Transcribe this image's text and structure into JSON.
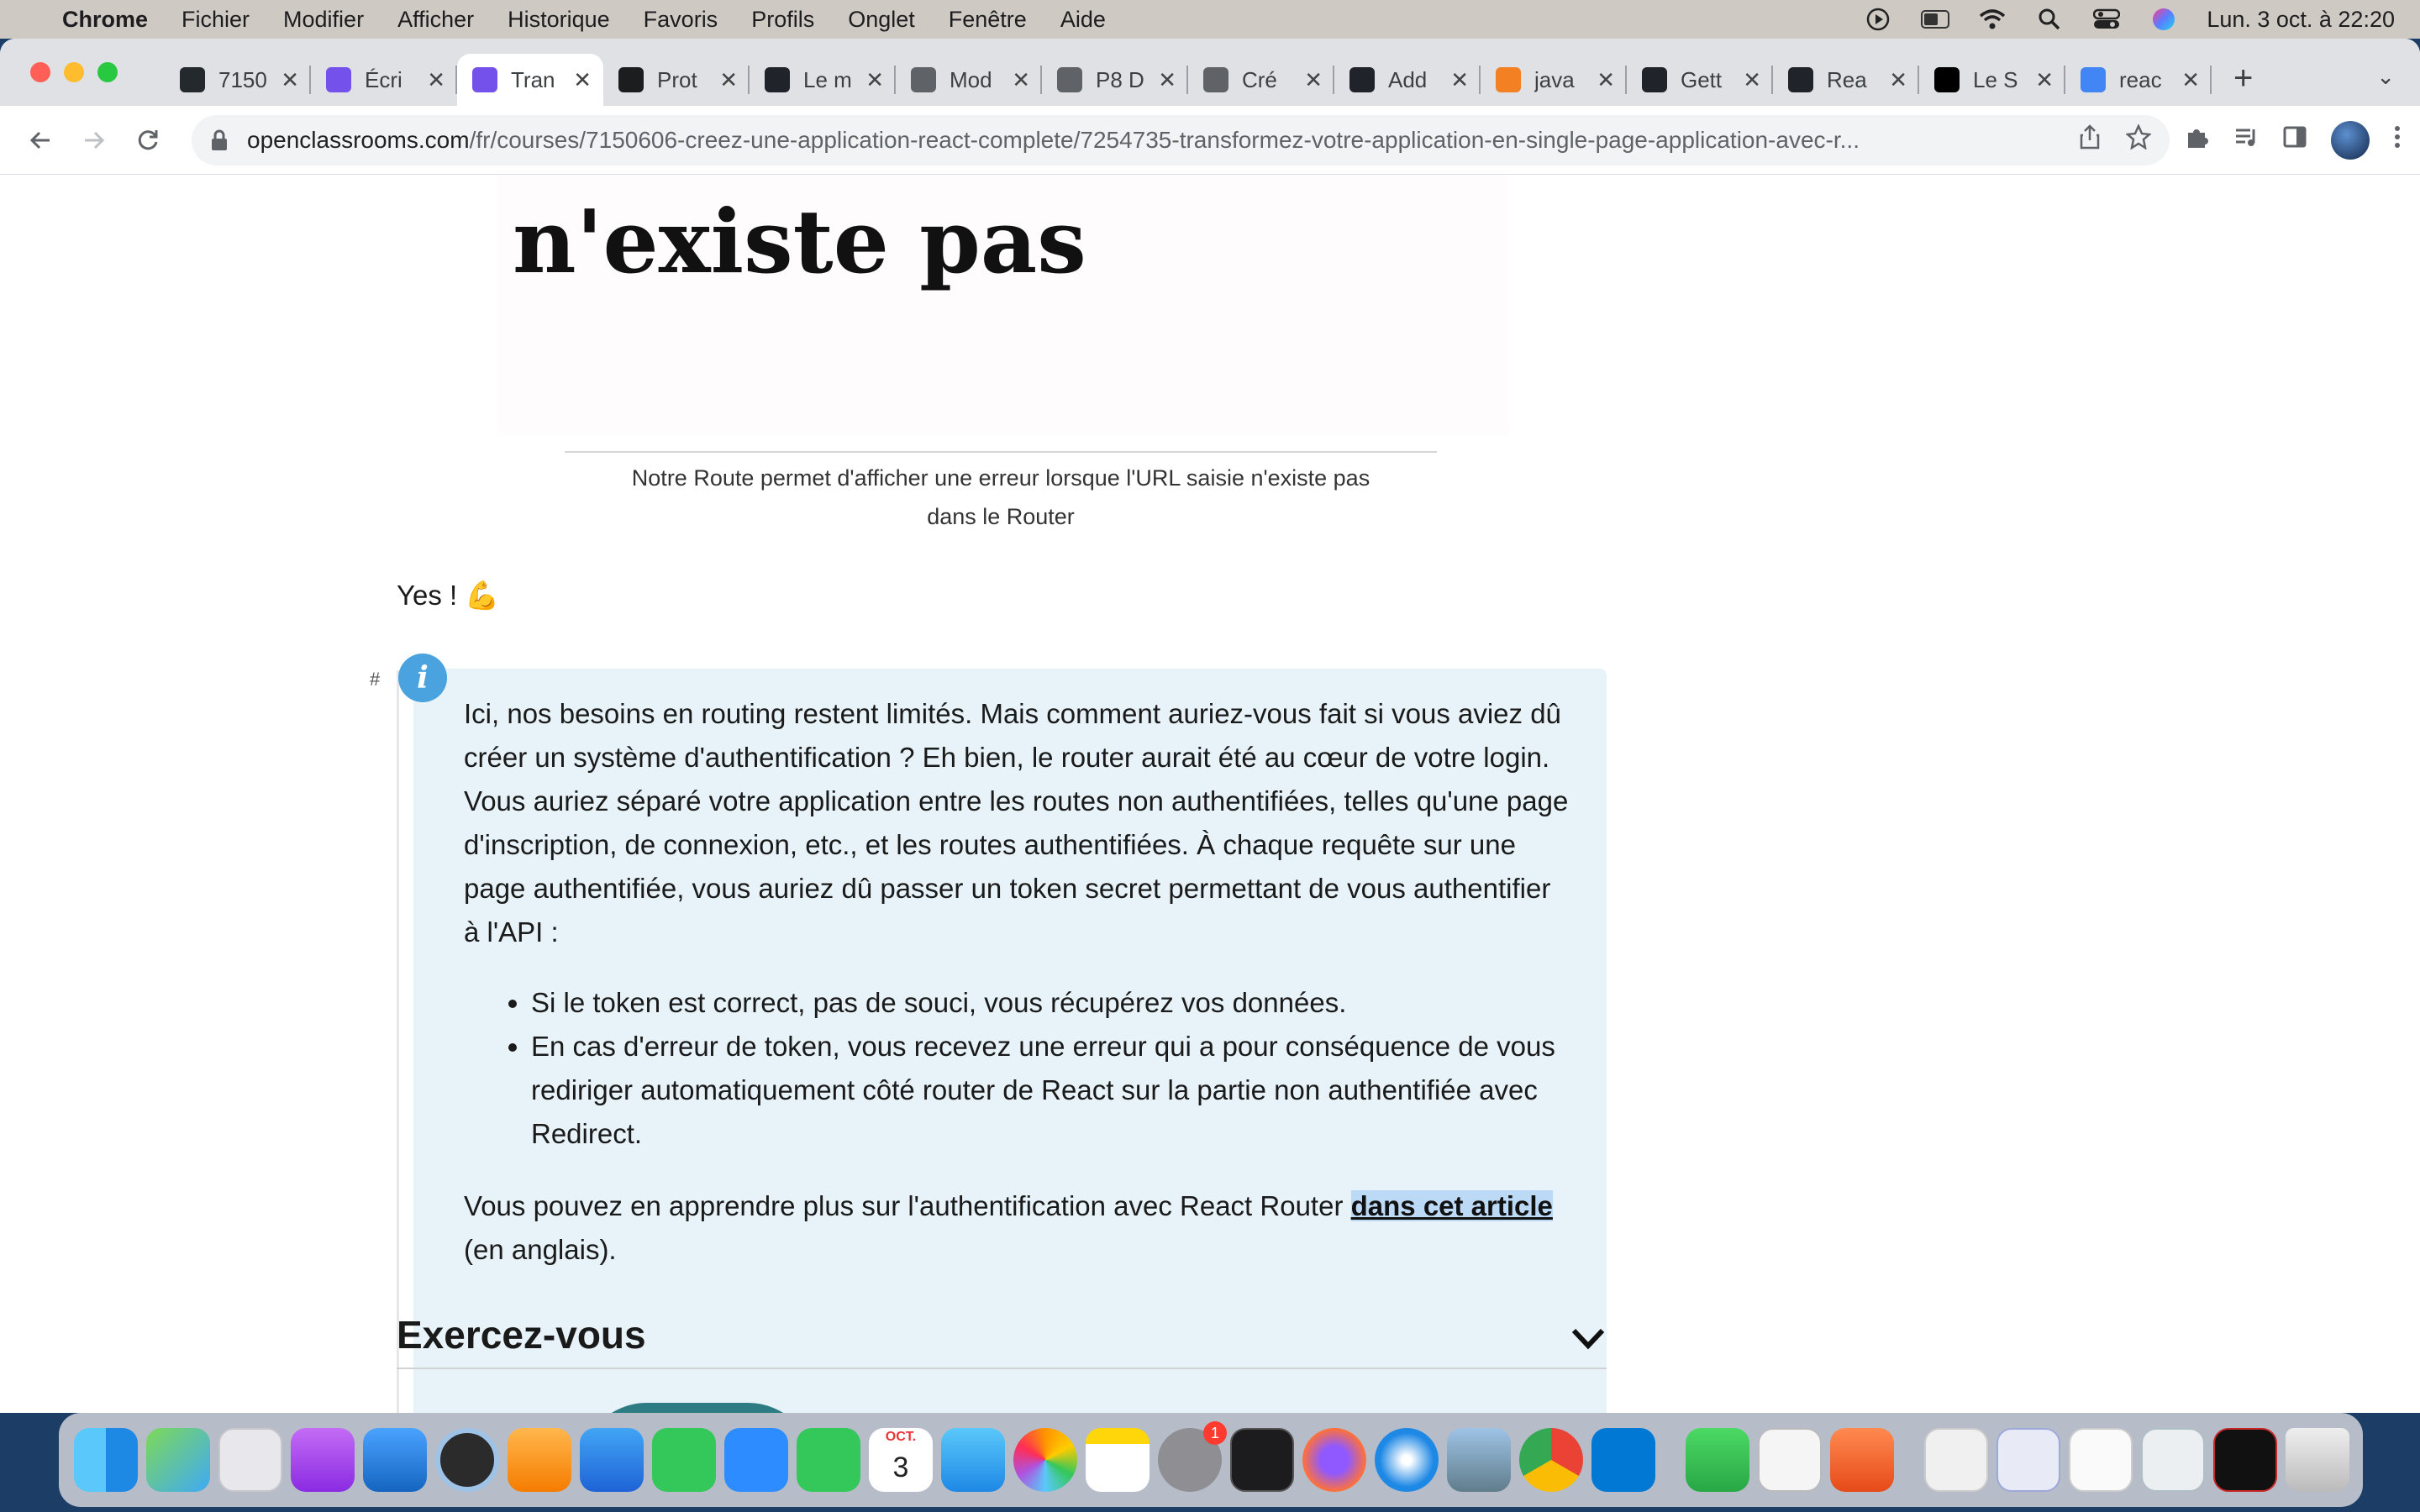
{
  "menubar": {
    "app": "Chrome",
    "items": [
      "Fichier",
      "Modifier",
      "Afficher",
      "Historique",
      "Favoris",
      "Profils",
      "Onglet",
      "Fenêtre",
      "Aide"
    ],
    "clock": "Lun. 3 oct. à  22:20"
  },
  "tabs": [
    {
      "label": "7150",
      "icon": "github-icon",
      "color": "#24292e"
    },
    {
      "label": "Écri",
      "icon": "openclassrooms-icon",
      "color": "#7451eb"
    },
    {
      "label": "Tran",
      "icon": "openclassrooms-icon",
      "color": "#7451eb",
      "active": true
    },
    {
      "label": "Prot",
      "icon": "udemy-icon",
      "color": "#1c1d1f"
    },
    {
      "label": "Le m",
      "icon": "react-icon",
      "color": "#20232a"
    },
    {
      "label": "Mod",
      "icon": "globe-icon",
      "color": "#5f6368"
    },
    {
      "label": "P8 D",
      "icon": "globe-icon",
      "color": "#5f6368"
    },
    {
      "label": "Cré",
      "icon": "globe-icon",
      "color": "#5f6368"
    },
    {
      "label": "Add",
      "icon": "react-icon",
      "color": "#20232a"
    },
    {
      "label": "java",
      "icon": "stackoverflow-icon",
      "color": "#f48024"
    },
    {
      "label": "Gett",
      "icon": "react-icon",
      "color": "#20232a"
    },
    {
      "label": "Rea",
      "icon": "react-icon",
      "color": "#20232a"
    },
    {
      "label": "Le S",
      "icon": "medium-icon",
      "color": "#000000"
    },
    {
      "label": "reac",
      "icon": "google-icon",
      "color": "#4285f4"
    }
  ],
  "address": {
    "domain": "openclassrooms.com",
    "path": "/fr/courses/7150606-creez-une-application-react-complete/7254735-transformez-votre-application-en-single-page-application-avec-r..."
  },
  "page": {
    "figure_text": "n'existe pas",
    "caption_line1": "Notre Route permet d'afficher une erreur lorsque l'URL saisie n'existe pas",
    "caption_line2": "dans le Router",
    "yes": "Yes ! 💪",
    "callout": {
      "anchor": "#",
      "paragraph": "Ici, nos besoins en routing restent limités. Mais comment auriez-vous fait si vous aviez dû créer un système d'authentification ? Eh bien, le router aurait été au cœur de votre login. Vous auriez séparé votre application entre les routes non authentifiées, telles qu'une page d'inscription, de connexion, etc., et les routes authentifiées. À chaque requête sur une page authentifiée, vous auriez dû passer un token secret permettant de vous authentifier à l'API :",
      "bullets": [
        "Si le token est correct, pas de souci, vous récupérez vos données.",
        "En cas d'erreur de token, vous recevez une erreur qui a pour conséquence de vous rediriger automatiquement côté router de React sur la partie non authentifiée avec Redirect."
      ],
      "closing_before": "Vous pouvez en apprendre plus sur l'authentification avec React Router ",
      "link": "dans cet article",
      "closing_after": " (en anglais)."
    },
    "section_title": "Exercez-vous"
  },
  "dock": {
    "calendar_month": "OCT.",
    "calendar_day": "3",
    "settings_badge": "1"
  }
}
